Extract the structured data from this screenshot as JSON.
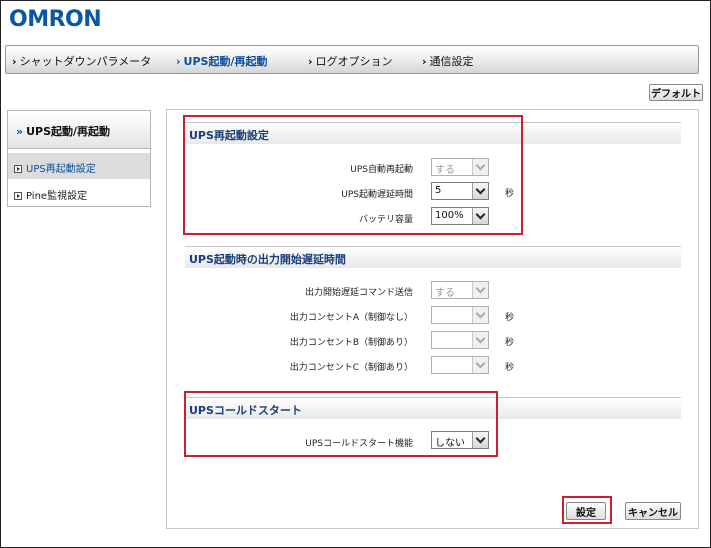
{
  "brand": {
    "logo": "OMRON"
  },
  "nav": {
    "items": [
      {
        "label": "シャットダウンパラメータ",
        "active": false
      },
      {
        "label": "UPS起動/再起動",
        "active": true
      },
      {
        "label": "ログオプション",
        "active": false
      },
      {
        "label": "通信設定",
        "active": false
      }
    ]
  },
  "toolbar": {
    "default_label": "デフォルト"
  },
  "sidebar": {
    "heading": "UPS起動/再起動",
    "items": [
      {
        "label": "UPS再起動設定",
        "active": true
      },
      {
        "label": "Pine監視設定",
        "active": false
      }
    ]
  },
  "sections": {
    "restart": {
      "title": "UPS再起動設定",
      "rows": [
        {
          "label": "UPS自動再起動",
          "value": "する",
          "disabled": true,
          "unit": ""
        },
        {
          "label": "UPS起動遅延時間",
          "value": "5",
          "disabled": false,
          "unit": "秒"
        },
        {
          "label": "バッテリ容量",
          "value": "100%",
          "disabled": false,
          "unit": ""
        }
      ]
    },
    "output_delay": {
      "title": "UPS起動時の出力開始遅延時間",
      "rows": [
        {
          "label": "出力開始遅延コマンド送信",
          "value": "する",
          "disabled": true,
          "unit": ""
        },
        {
          "label": "出力コンセントA（制御なし）",
          "value": "",
          "disabled": true,
          "unit": "秒"
        },
        {
          "label": "出力コンセントB（制御あり）",
          "value": "",
          "disabled": true,
          "unit": "秒"
        },
        {
          "label": "出力コンセントC（制御あり）",
          "value": "",
          "disabled": true,
          "unit": "秒"
        }
      ]
    },
    "cold_start": {
      "title": "UPSコールドスタート",
      "rows": [
        {
          "label": "UPSコールドスタート機能",
          "value": "しない",
          "disabled": false,
          "unit": ""
        }
      ]
    }
  },
  "actions": {
    "apply_label": "設定",
    "cancel_label": "キャンセル"
  },
  "colors": {
    "brand": "#0a57a8",
    "highlight": "#cc1f2e",
    "section_title": "#1a3e7a"
  }
}
